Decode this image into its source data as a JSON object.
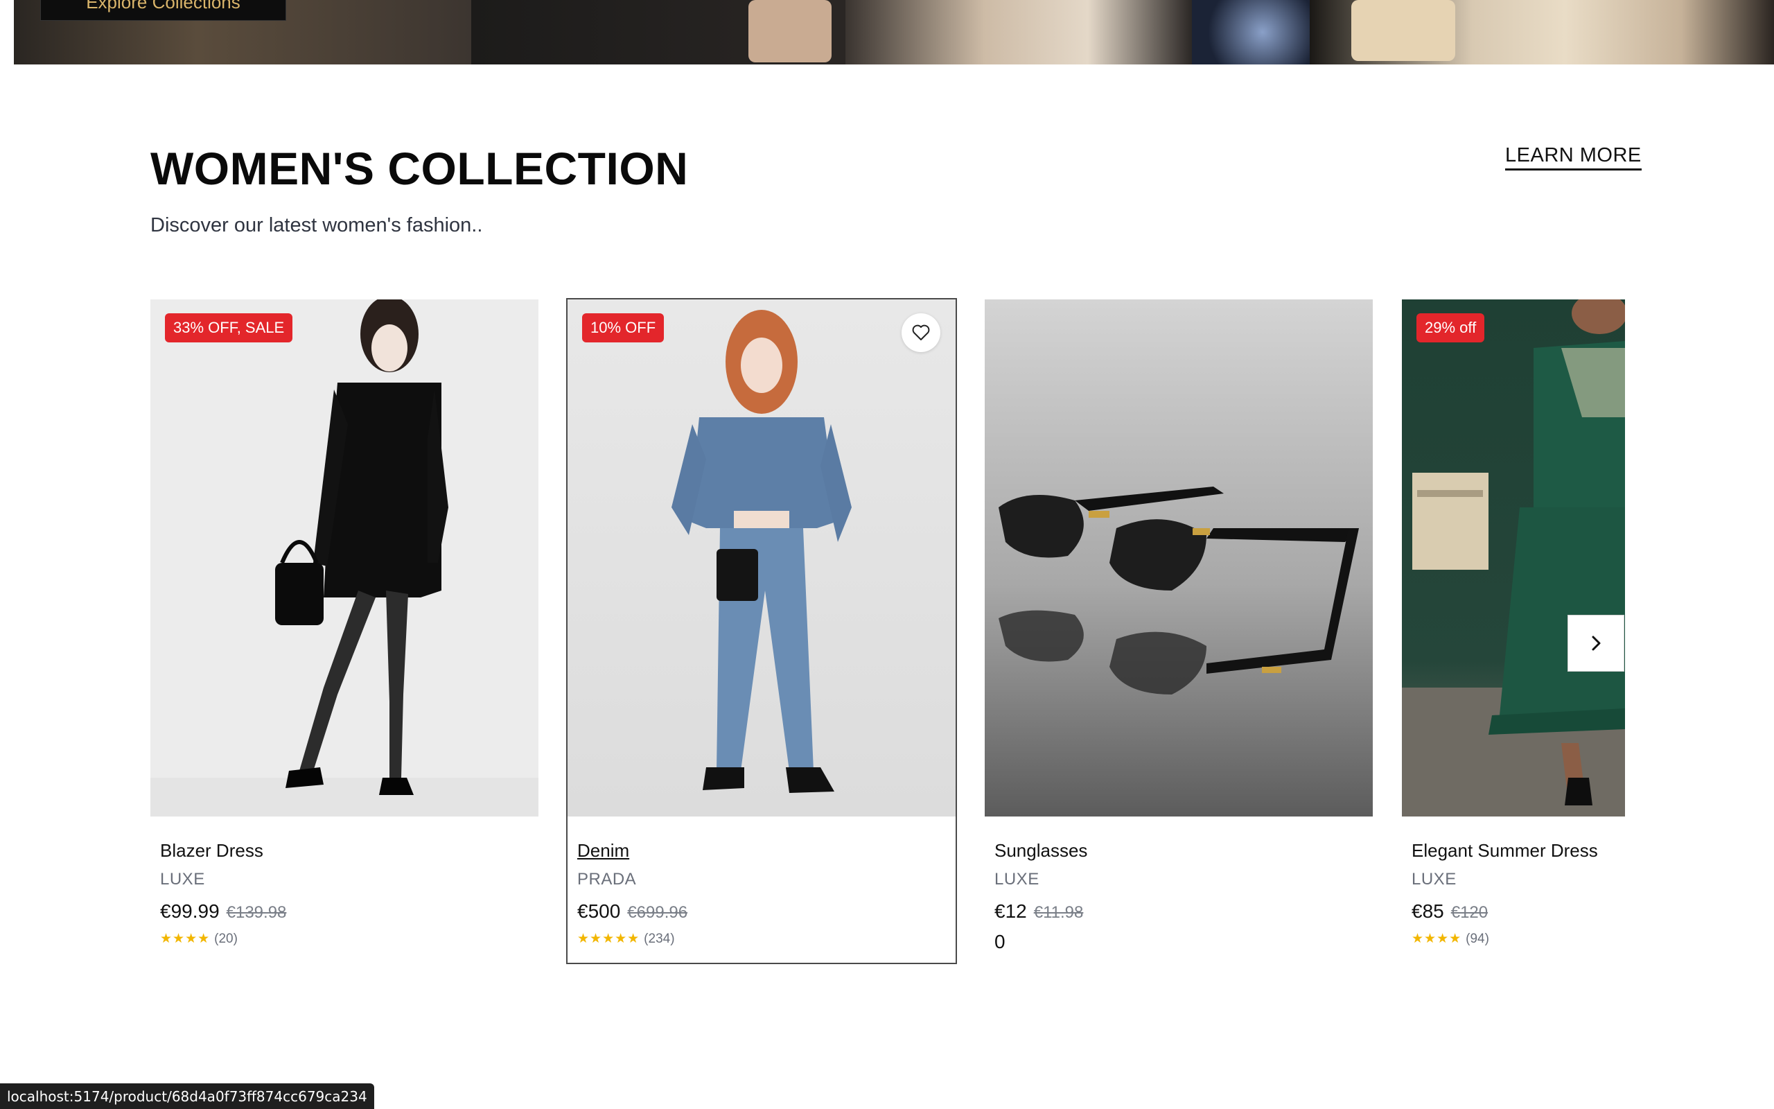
{
  "hero": {
    "cta_label": "Explore Collections"
  },
  "section": {
    "title": "WOMEN'S COLLECTION",
    "subtitle": "Discover our latest women's fashion..",
    "learn_more": "LEARN MORE"
  },
  "products": [
    {
      "badge": "33% OFF, SALE",
      "name": "Blazer Dress",
      "brand": "LUXE",
      "price": "€99.99",
      "old_price": "€139.98",
      "stars": "★★★★",
      "reviews": "(20)"
    },
    {
      "badge": "10% OFF",
      "name": "Denim",
      "brand": "PRADA",
      "price": "€500",
      "old_price": "€699.96",
      "stars": "★★★★★",
      "reviews": "(234)"
    },
    {
      "name": "Sunglasses",
      "brand": "LUXE",
      "price": "€12",
      "old_price": "€11.98",
      "rating_text": "0"
    },
    {
      "badge": "29% off",
      "name": "Elegant Summer Dress",
      "brand": "LUXE",
      "price": "€85",
      "old_price": "€120",
      "stars": "★★★★",
      "reviews": "(94)"
    }
  ],
  "icons": {
    "favorite": "heart-icon",
    "next": "chevron-right-icon"
  },
  "status_bar": {
    "url": "localhost:5174/product/68d4a0f73ff874cc679ca234"
  },
  "colors": {
    "sale_badge": "#e3262b",
    "stars": "#f2b600",
    "accent_gold": "#d9b46a"
  }
}
